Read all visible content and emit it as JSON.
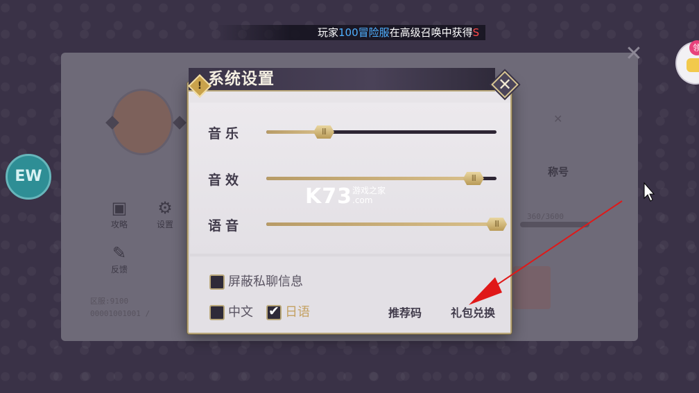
{
  "marquee": {
    "prefix": "玩家",
    "player": "100冒险服",
    "middle": "在高级召唤中获得",
    "suffix": "S"
  },
  "background": {
    "icon_left_float": "EW",
    "badge_right_float": "领",
    "button_1_label": "攻略",
    "button_2_label": "设置",
    "button_3_label": "反馈",
    "text_line_1": "区服:9100",
    "text_line_2": "00001001001 /",
    "right_title": "称号",
    "right_value": "360/3600"
  },
  "dialog": {
    "title": "系统设置",
    "title_icon": "!",
    "close_icon": "close-icon",
    "sliders": [
      {
        "label": "音乐",
        "value": 0.25
      },
      {
        "label": "音效",
        "value": 0.9
      },
      {
        "label": "语音",
        "value": 1.0
      }
    ],
    "options": {
      "block_private_chat": {
        "label": "屏蔽私聊信息",
        "checked": false
      },
      "lang_chinese": {
        "label": "中文",
        "checked": false
      },
      "lang_japanese": {
        "label": "日语",
        "checked": true
      }
    },
    "buttons": {
      "referral": "推荐码",
      "gift_redeem": "礼包兑换"
    }
  },
  "watermark": {
    "logo": "K73",
    "line1": "游戏之家",
    "line2": ".com"
  },
  "colors": {
    "accent_gold": "#c9a24c",
    "panel_bg": "#e3e0e5",
    "header_bg": "#3a3347",
    "annotation_red": "#e01818"
  }
}
